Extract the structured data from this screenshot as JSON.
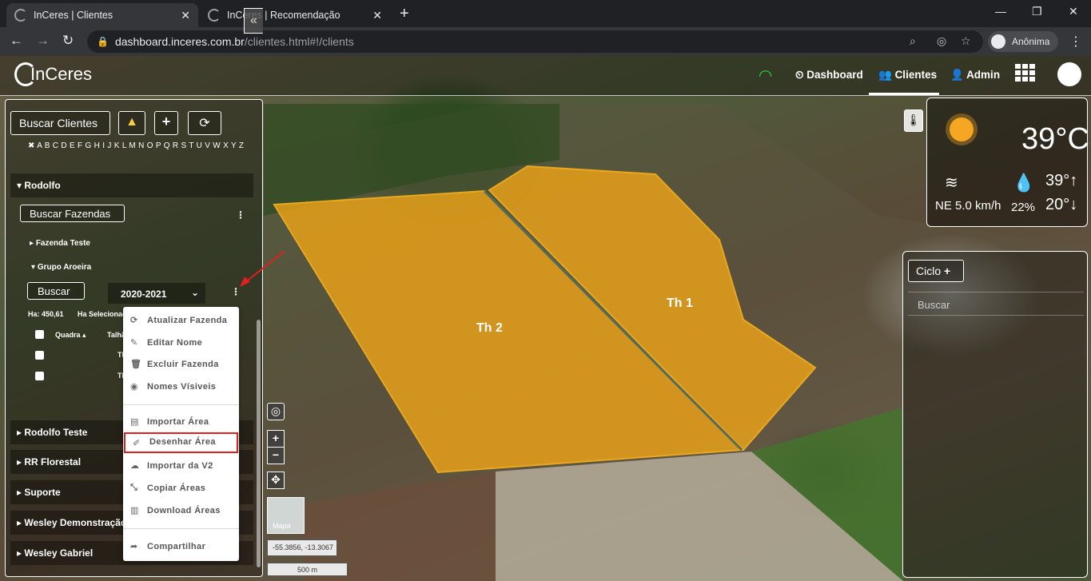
{
  "browser": {
    "tabs": [
      {
        "title": "InCeres | Clientes",
        "active": true
      },
      {
        "title": "InCeres | Recomendação",
        "active": false
      }
    ],
    "url_domain": "dashboard.inceres.com.br",
    "url_path": "/clientes.html#!/clients",
    "profile_label": "Anônima"
  },
  "app": {
    "logo": "InCeres",
    "nav": {
      "dashboard": "Dashboard",
      "clientes": "Clientes",
      "admin": "Admin"
    }
  },
  "sidebar": {
    "search_clients": "Buscar Clientes",
    "alphabet": "✖ A B C D E F G H I J K L M N O P Q R S T U V W X Y Z",
    "client_open": "Rodolfo",
    "search_farms": "Buscar Fazendas",
    "farms": [
      "Fazenda Teste",
      "Grupo Aroeira"
    ],
    "search_label": "Buscar",
    "season": "2020-2021",
    "ha_total": "Ha: 450,61",
    "ha_selected": "Ha Selecionadas",
    "columns": [
      "Quadra",
      "Talhão"
    ],
    "rows": [
      "Th",
      "Th"
    ],
    "clients": [
      "Rodolfo Teste",
      "RR Florestal",
      "Suporte",
      "Wesley Demonstração",
      "Wesley Gabriel"
    ]
  },
  "menu": {
    "items": [
      {
        "label": "Atualizar Fazenda",
        "icon": "refresh-icon"
      },
      {
        "label": "Editar Nome",
        "icon": "pencil-icon"
      },
      {
        "label": "Excluir Fazenda",
        "icon": "trash-icon"
      },
      {
        "label": "Nomes Vísiveis",
        "icon": "eye-icon"
      },
      {
        "label": "Importar Área",
        "icon": "file-icon"
      },
      {
        "label": "Desenhar Área",
        "icon": "brush-icon",
        "highlighted": true
      },
      {
        "label": "Importar da V2",
        "icon": "cloud-icon"
      },
      {
        "label": "Copiar Áreas",
        "icon": "compress-icon"
      },
      {
        "label": "Download Áreas",
        "icon": "download-file-icon"
      },
      {
        "label": "Compartilhar",
        "icon": "share-icon"
      }
    ]
  },
  "map": {
    "fields": [
      "Th 2",
      "Th 1"
    ],
    "basemap_label": "Mapa",
    "coords": "-55.3856, -13.3067",
    "scale": "500 m",
    "field_color": "#e0a020",
    "highlight_color": "#e02020"
  },
  "weather": {
    "temp": "39°C",
    "wind": "NE 5.0 km/h",
    "humidity": "22%",
    "max": "39°",
    "min": "20°"
  },
  "ciclo": {
    "button": "Ciclo",
    "search_placeholder": "Buscar"
  }
}
